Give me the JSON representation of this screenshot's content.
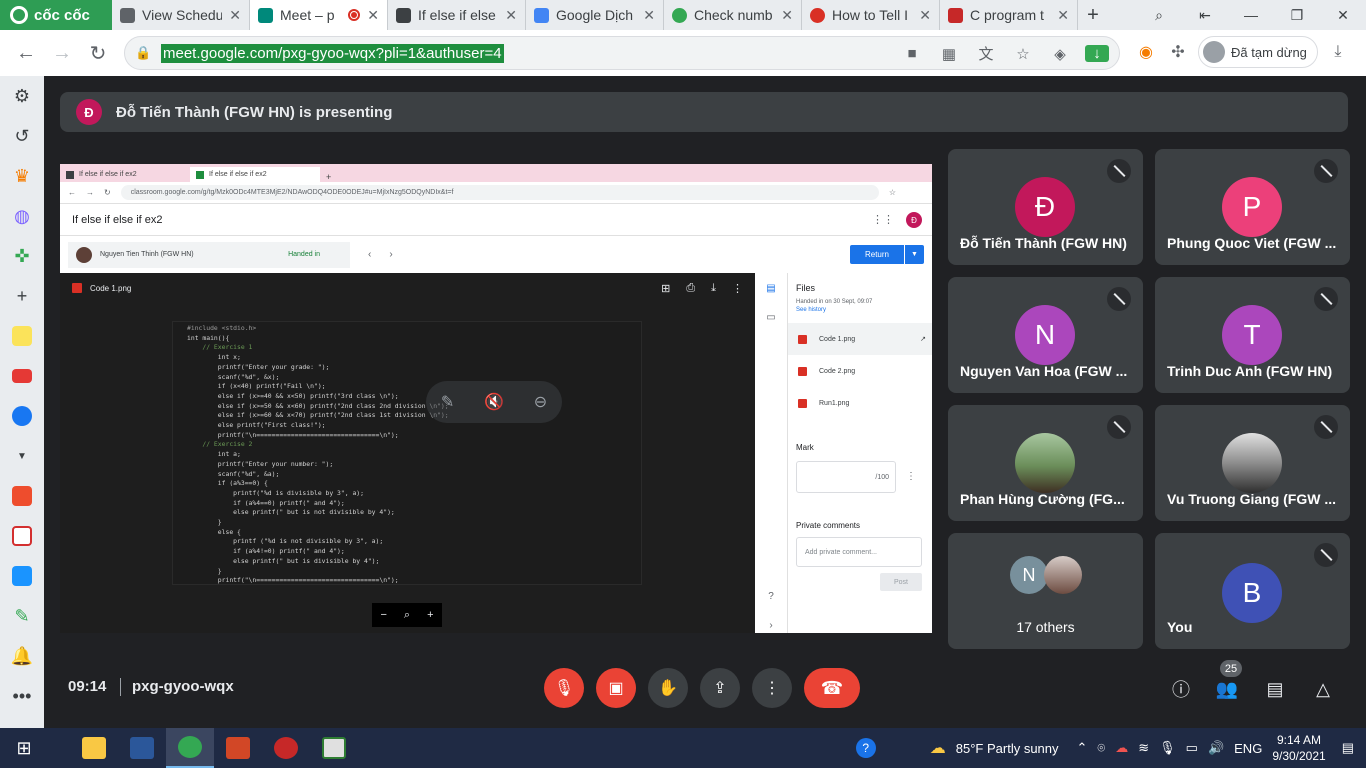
{
  "browser": {
    "name": "cốc cốc",
    "tabs": [
      {
        "label": "View Schedu",
        "color": "#5f6368"
      },
      {
        "label": "Meet – p",
        "color": "#00897b",
        "active": true
      },
      {
        "label": "If else if else",
        "color": "#3c4043"
      },
      {
        "label": "Google Dịch",
        "color": "#4285f4"
      },
      {
        "label": "Check numb",
        "color": "#34a853"
      },
      {
        "label": "How to Tell I",
        "color": "#d93025"
      },
      {
        "label": "C program t",
        "color": "#c62828"
      }
    ],
    "url": "meet.google.com/pxg-gyoo-wqx?pli=1&authuser=4",
    "profile_status": "Đã tạm dừng"
  },
  "banner": {
    "avatar_letter": "Đ",
    "text": "Đỗ Tiến Thành (FGW HN) is presenting"
  },
  "shared": {
    "tab1": "If else if else if ex2",
    "tab2": "If else if else if ex2",
    "url": "classroom.google.com/g/tg/Mzk0ODc4MTE3MjE2/NDAwODQ4ODE0ODEJ#u=MjIxNzg5ODQyNDIx&t=f",
    "title": "If else if else if ex2",
    "avatar_letter": "Đ",
    "student_name": "Nguyen Tien Thinh (FGW HN)",
    "status": "Handed in",
    "return_label": "Return",
    "file_name": "Code 1.png",
    "files_title": "Files",
    "handed_time": "Handed in on 30 Sept, 09:07",
    "see_history": "See history",
    "files": [
      "Code 1.png",
      "Code 2.png",
      "Run1.png"
    ],
    "mark_label": "Mark",
    "mark_suffix": "/100",
    "private_label": "Private comments",
    "private_placeholder": "Add private comment...",
    "post_label": "Post",
    "code_lines": [
      "#include <stdio.h>",
      "int main(){",
      "    // Exercise 1",
      "        int x;",
      "        printf(\"Enter your grade: \");",
      "        scanf(\"%d\", &x);",
      "        if (x<40) printf(\"Fail \\n\");",
      "        else if (x>=40 && x<50) printf(\"3rd class \\n\");",
      "        else if (x>=50 && x<60) printf(\"2nd class 2nd division \\n\");",
      "        else if (x>=60 && x<70) printf(\"2nd class 1st division \\n\");",
      "        else printf(\"First class!\");",
      "        printf(\"\\n================================\\n\");",
      "    // Exercise 2",
      "        int a;",
      "        printf(\"Enter your number: \");",
      "        scanf(\"%d\", &a);",
      "        if (a%3==0) {",
      "            printf(\"%d is divisible by 3\", a);",
      "            if (a%4==0) printf(\" and 4\");",
      "            else printf(\" but is not divisible by 4\");",
      "        }",
      "        else {",
      "            printf (\"%d is not divisible by 3\", a);",
      "            if (a%4!=0) printf(\" and 4\");",
      "            else printf(\" but is divisible by 4\");",
      "        }",
      "        printf(\"\\n================================\\n\");"
    ]
  },
  "participants": [
    {
      "name": "Đỗ Tiến Thành (FGW HN)",
      "letter": "Đ",
      "color": "#c2185b"
    },
    {
      "name": "Phung Quoc Viet (FGW ...",
      "letter": "P",
      "color": "#ec407a"
    },
    {
      "name": "Nguyen Van Hoa (FGW ...",
      "letter": "N",
      "color": "#ab47bc"
    },
    {
      "name": "Trinh Duc Anh (FGW HN)",
      "letter": "T",
      "color": "#ab47bc"
    },
    {
      "name": "Phan Hùng Cường (FG...",
      "letter": "",
      "color": "#6b8e5a"
    },
    {
      "name": "Vu Truong Giang (FGW ...",
      "letter": "",
      "color": "#8d8d8d"
    },
    {
      "name": "17 others",
      "letter": "N",
      "color": "#78909c"
    },
    {
      "name": "You",
      "letter": "B",
      "color": "#3f51b5"
    }
  ],
  "bottom": {
    "time": "09:14",
    "meeting_code": "pxg-gyoo-wqx",
    "participant_count": "25"
  },
  "taskbar": {
    "weather": "85°F  Partly sunny",
    "lang": "ENG",
    "time": "9:14 AM",
    "date": "9/30/2021"
  }
}
